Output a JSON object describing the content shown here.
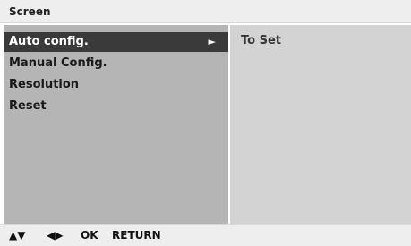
{
  "title": "Screen",
  "menu": {
    "items": [
      {
        "label": "Auto config.",
        "selected": true,
        "arrow": "►"
      },
      {
        "label": "Manual Config.",
        "selected": false
      },
      {
        "label": "Resolution",
        "selected": false
      },
      {
        "label": "Reset",
        "selected": false
      }
    ]
  },
  "option": {
    "value": "To Set"
  },
  "footer": {
    "up_down": "▲▼",
    "left_right": "◀▶",
    "ok": "OK",
    "return": "RETURN"
  },
  "colors": {
    "left_panel": "#b5b5b5",
    "right_panel": "#d3d3d3",
    "selected_item": "#3a3a3a",
    "bars": "#eeeeee"
  }
}
